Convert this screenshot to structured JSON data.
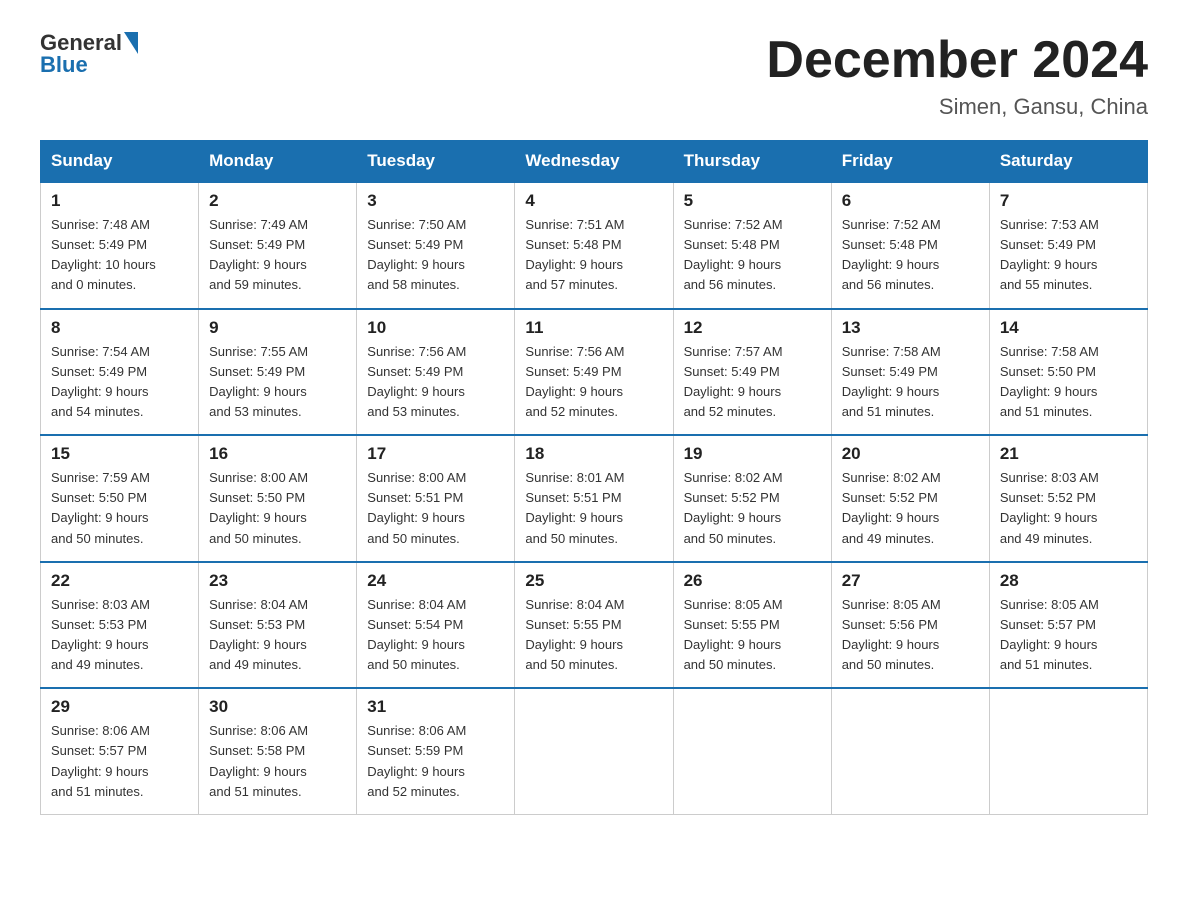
{
  "logo": {
    "general": "General",
    "blue": "Blue"
  },
  "header": {
    "month_title": "December 2024",
    "location": "Simen, Gansu, China"
  },
  "days_of_week": [
    "Sunday",
    "Monday",
    "Tuesday",
    "Wednesday",
    "Thursday",
    "Friday",
    "Saturday"
  ],
  "weeks": [
    [
      {
        "num": "1",
        "sunrise": "7:48 AM",
        "sunset": "5:49 PM",
        "daylight": "10 hours and 0 minutes."
      },
      {
        "num": "2",
        "sunrise": "7:49 AM",
        "sunset": "5:49 PM",
        "daylight": "9 hours and 59 minutes."
      },
      {
        "num": "3",
        "sunrise": "7:50 AM",
        "sunset": "5:49 PM",
        "daylight": "9 hours and 58 minutes."
      },
      {
        "num": "4",
        "sunrise": "7:51 AM",
        "sunset": "5:48 PM",
        "daylight": "9 hours and 57 minutes."
      },
      {
        "num": "5",
        "sunrise": "7:52 AM",
        "sunset": "5:48 PM",
        "daylight": "9 hours and 56 minutes."
      },
      {
        "num": "6",
        "sunrise": "7:52 AM",
        "sunset": "5:48 PM",
        "daylight": "9 hours and 56 minutes."
      },
      {
        "num": "7",
        "sunrise": "7:53 AM",
        "sunset": "5:49 PM",
        "daylight": "9 hours and 55 minutes."
      }
    ],
    [
      {
        "num": "8",
        "sunrise": "7:54 AM",
        "sunset": "5:49 PM",
        "daylight": "9 hours and 54 minutes."
      },
      {
        "num": "9",
        "sunrise": "7:55 AM",
        "sunset": "5:49 PM",
        "daylight": "9 hours and 53 minutes."
      },
      {
        "num": "10",
        "sunrise": "7:56 AM",
        "sunset": "5:49 PM",
        "daylight": "9 hours and 53 minutes."
      },
      {
        "num": "11",
        "sunrise": "7:56 AM",
        "sunset": "5:49 PM",
        "daylight": "9 hours and 52 minutes."
      },
      {
        "num": "12",
        "sunrise": "7:57 AM",
        "sunset": "5:49 PM",
        "daylight": "9 hours and 52 minutes."
      },
      {
        "num": "13",
        "sunrise": "7:58 AM",
        "sunset": "5:49 PM",
        "daylight": "9 hours and 51 minutes."
      },
      {
        "num": "14",
        "sunrise": "7:58 AM",
        "sunset": "5:50 PM",
        "daylight": "9 hours and 51 minutes."
      }
    ],
    [
      {
        "num": "15",
        "sunrise": "7:59 AM",
        "sunset": "5:50 PM",
        "daylight": "9 hours and 50 minutes."
      },
      {
        "num": "16",
        "sunrise": "8:00 AM",
        "sunset": "5:50 PM",
        "daylight": "9 hours and 50 minutes."
      },
      {
        "num": "17",
        "sunrise": "8:00 AM",
        "sunset": "5:51 PM",
        "daylight": "9 hours and 50 minutes."
      },
      {
        "num": "18",
        "sunrise": "8:01 AM",
        "sunset": "5:51 PM",
        "daylight": "9 hours and 50 minutes."
      },
      {
        "num": "19",
        "sunrise": "8:02 AM",
        "sunset": "5:52 PM",
        "daylight": "9 hours and 50 minutes."
      },
      {
        "num": "20",
        "sunrise": "8:02 AM",
        "sunset": "5:52 PM",
        "daylight": "9 hours and 49 minutes."
      },
      {
        "num": "21",
        "sunrise": "8:03 AM",
        "sunset": "5:52 PM",
        "daylight": "9 hours and 49 minutes."
      }
    ],
    [
      {
        "num": "22",
        "sunrise": "8:03 AM",
        "sunset": "5:53 PM",
        "daylight": "9 hours and 49 minutes."
      },
      {
        "num": "23",
        "sunrise": "8:04 AM",
        "sunset": "5:53 PM",
        "daylight": "9 hours and 49 minutes."
      },
      {
        "num": "24",
        "sunrise": "8:04 AM",
        "sunset": "5:54 PM",
        "daylight": "9 hours and 50 minutes."
      },
      {
        "num": "25",
        "sunrise": "8:04 AM",
        "sunset": "5:55 PM",
        "daylight": "9 hours and 50 minutes."
      },
      {
        "num": "26",
        "sunrise": "8:05 AM",
        "sunset": "5:55 PM",
        "daylight": "9 hours and 50 minutes."
      },
      {
        "num": "27",
        "sunrise": "8:05 AM",
        "sunset": "5:56 PM",
        "daylight": "9 hours and 50 minutes."
      },
      {
        "num": "28",
        "sunrise": "8:05 AM",
        "sunset": "5:57 PM",
        "daylight": "9 hours and 51 minutes."
      }
    ],
    [
      {
        "num": "29",
        "sunrise": "8:06 AM",
        "sunset": "5:57 PM",
        "daylight": "9 hours and 51 minutes."
      },
      {
        "num": "30",
        "sunrise": "8:06 AM",
        "sunset": "5:58 PM",
        "daylight": "9 hours and 51 minutes."
      },
      {
        "num": "31",
        "sunrise": "8:06 AM",
        "sunset": "5:59 PM",
        "daylight": "9 hours and 52 minutes."
      },
      null,
      null,
      null,
      null
    ]
  ],
  "labels": {
    "sunrise": "Sunrise:",
    "sunset": "Sunset:",
    "daylight": "Daylight:"
  }
}
